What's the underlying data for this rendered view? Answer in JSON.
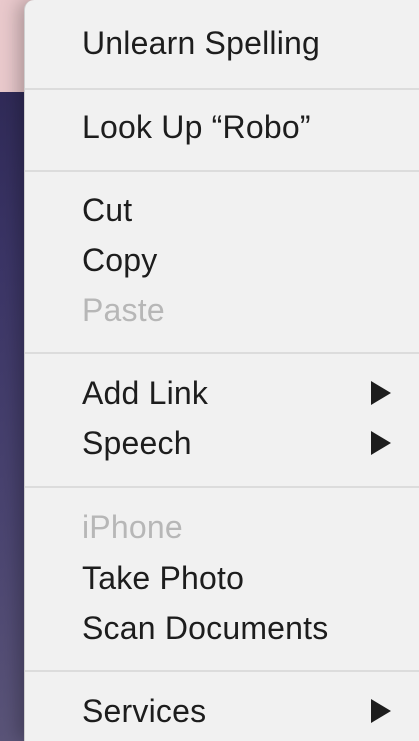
{
  "menu": {
    "unlearn_spelling": "Unlearn Spelling",
    "look_up": "Look Up “Robo”",
    "cut": "Cut",
    "copy": "Copy",
    "paste": "Paste",
    "add_link": "Add Link",
    "speech": "Speech",
    "iphone_header": "iPhone",
    "take_photo": "Take Photo",
    "scan_documents": "Scan Documents",
    "services": "Services"
  },
  "icons": {
    "submenu_arrow": "triangle-right-icon"
  },
  "colors": {
    "menu_background": "#f1f1f1",
    "text": "#1d1d1d",
    "disabled_text": "#b7b7b7",
    "separator": "#dcdcdc"
  }
}
